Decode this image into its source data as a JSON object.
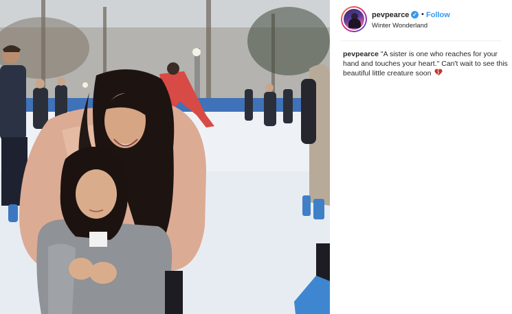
{
  "post": {
    "username": "pevpearce",
    "verified_mark": "✓",
    "separator": "•",
    "follow_label": "Follow",
    "location": "Winter Wonderland"
  },
  "caption": {
    "username": "pevpearce",
    "text": "\"A sister is one who reaches for your hand and touches your heart.\" Can't wait to see this beautiful little creature soon",
    "emoji": "broken-heart-icon"
  },
  "colors": {
    "accent": "#3897f0",
    "text": "#262626",
    "heart": "#c0392b"
  }
}
